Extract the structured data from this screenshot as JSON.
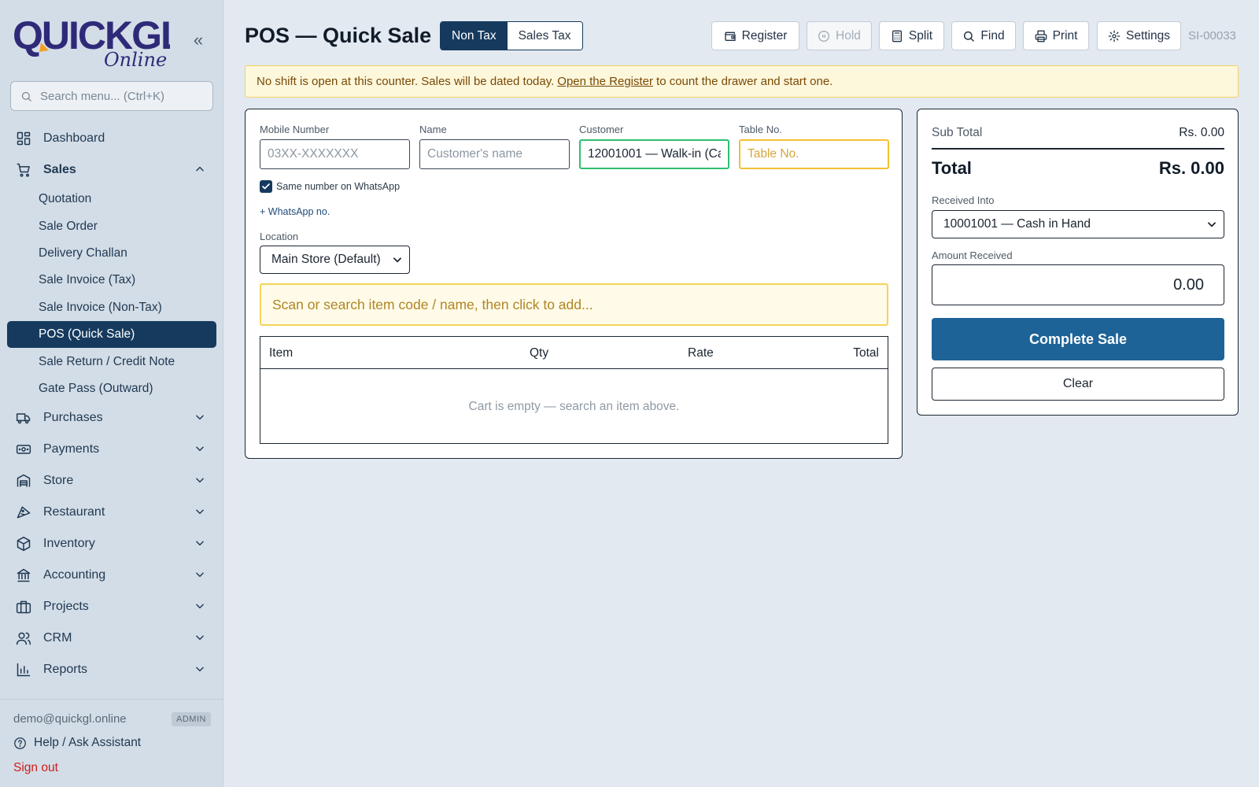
{
  "sidebar": {
    "logo": {
      "word": "QUICKGL",
      "sub": "Online",
      "brand_color": "#2f2a78",
      "accent_color": "#f0a02a"
    },
    "collapse_icon": "double-chevron-left-icon",
    "search_placeholder": "Search menu... (Ctrl+K)",
    "nav": [
      {
        "label": "Dashboard",
        "icon": "dashboard-icon"
      },
      {
        "label": "Sales",
        "icon": "cart-icon",
        "expanded": true,
        "children": [
          "Quotation",
          "Sale Order",
          "Delivery Challan",
          "Sale Invoice (Tax)",
          "Sale Invoice (Non-Tax)",
          "POS (Quick Sale)",
          "Sale Return / Credit Note",
          "Gate Pass (Outward)"
        ],
        "active_child": "POS (Quick Sale)"
      },
      {
        "label": "Purchases",
        "icon": "truck-icon"
      },
      {
        "label": "Payments",
        "icon": "cash-icon"
      },
      {
        "label": "Store",
        "icon": "warehouse-icon"
      },
      {
        "label": "Restaurant",
        "icon": "restaurant-icon"
      },
      {
        "label": "Inventory",
        "icon": "box-icon"
      },
      {
        "label": "Accounting",
        "icon": "bank-icon"
      },
      {
        "label": "Projects",
        "icon": "briefcase-icon"
      },
      {
        "label": "CRM",
        "icon": "users-icon"
      },
      {
        "label": "Reports",
        "icon": "bar-chart-icon"
      }
    ],
    "footer": {
      "email": "demo@quickgl.online",
      "role": "ADMIN",
      "help": "Help / Ask Assistant",
      "signout": "Sign out"
    }
  },
  "header": {
    "title": "POS — Quick Sale",
    "tax_modes": [
      "Non Tax",
      "Sales Tax"
    ],
    "tax_mode_selected": "Non Tax",
    "toolbar": [
      {
        "label": "Register",
        "icon": "wallet-icon",
        "disabled": false
      },
      {
        "label": "Hold",
        "icon": "pause-icon",
        "disabled": true
      },
      {
        "label": "Split",
        "icon": "calculator-icon",
        "disabled": false
      },
      {
        "label": "Find",
        "icon": "search-icon",
        "disabled": false
      },
      {
        "label": "Print",
        "icon": "printer-icon",
        "disabled": false
      },
      {
        "label": "Settings",
        "icon": "gear-icon",
        "disabled": false
      }
    ],
    "doc_no": "SI-00033"
  },
  "alert": {
    "before": "No shift is open at this counter. Sales will be dated today.",
    "link": "Open the Register",
    "after": "to count the drawer and start one.",
    "color": "#7a4a05"
  },
  "form": {
    "mobile": {
      "label": "Mobile Number",
      "placeholder": "03XX-XXXXXXX",
      "value": ""
    },
    "name": {
      "label": "Name",
      "placeholder": "Customer's name",
      "value": ""
    },
    "customer": {
      "label": "Customer",
      "value": "12001001 — Walk-in (Ca"
    },
    "table_no": {
      "label": "Table No.",
      "placeholder": "Table No.",
      "value": ""
    },
    "whatsapp_same": {
      "label": "Same number on WhatsApp",
      "checked": true
    },
    "whatsapp_add": "+ WhatsApp no.",
    "location": {
      "label": "Location",
      "value": "Main Store (Default)"
    },
    "scan_placeholder": "Scan or search item code / name, then click to add..."
  },
  "cart": {
    "columns": [
      "Item",
      "Qty",
      "Rate",
      "Total"
    ],
    "rows": [],
    "empty_text": "Cart is empty — search an item above."
  },
  "summary": {
    "subtotal_label": "Sub Total",
    "subtotal_value": "Rs. 0.00",
    "total_label": "Total",
    "total_value": "Rs. 0.00",
    "received_into_label": "Received Into",
    "received_into_value": "10001001 — Cash in Hand",
    "amount_received_label": "Amount Received",
    "amount_received_value": "0.00",
    "complete_label": "Complete Sale",
    "clear_label": "Clear",
    "primary_color": "#1e6398"
  }
}
